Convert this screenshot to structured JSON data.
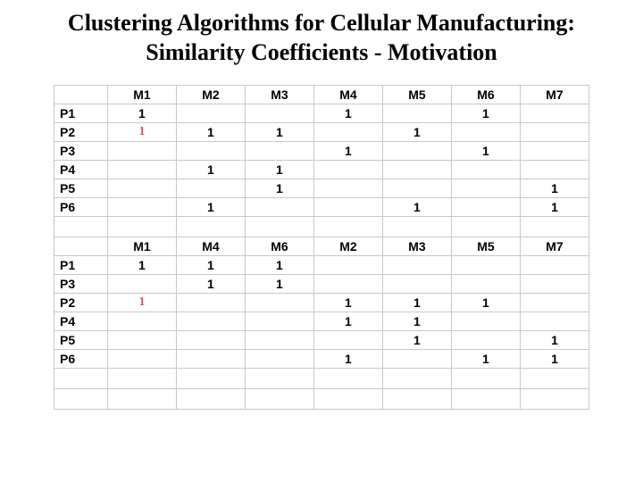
{
  "title_line1": "Clustering Algorithms for Cellular Manufacturing:",
  "title_line2": "Similarity Coefficients - Motivation",
  "table1": {
    "headers": [
      "",
      "M1",
      "M2",
      "M3",
      "M4",
      "M5",
      "M6",
      "M7"
    ],
    "rows": [
      {
        "label": "P1",
        "cells": [
          "1",
          "",
          "",
          "1",
          "",
          "1",
          ""
        ]
      },
      {
        "label": "P2",
        "cells": [
          "1",
          "1",
          "1",
          "",
          "1",
          "",
          ""
        ],
        "red_cols": [
          0
        ]
      },
      {
        "label": "P3",
        "cells": [
          "",
          "",
          "",
          "1",
          "",
          "1",
          ""
        ]
      },
      {
        "label": "P4",
        "cells": [
          "",
          "1",
          "1",
          "",
          "",
          "",
          ""
        ]
      },
      {
        "label": "P5",
        "cells": [
          "",
          "",
          "1",
          "",
          "",
          "",
          "1"
        ]
      },
      {
        "label": "P6",
        "cells": [
          "",
          "1",
          "",
          "",
          "1",
          "",
          "1"
        ]
      }
    ]
  },
  "table2": {
    "headers": [
      "",
      "M1",
      "M4",
      "M6",
      "M2",
      "M3",
      "M5",
      "M7"
    ],
    "rows": [
      {
        "label": "P1",
        "cells": [
          "1",
          "1",
          "1",
          "",
          "",
          "",
          ""
        ]
      },
      {
        "label": "P3",
        "cells": [
          "",
          "1",
          "1",
          "",
          "",
          "",
          ""
        ]
      },
      {
        "label": "P2",
        "cells": [
          "1",
          "",
          "",
          "1",
          "1",
          "1",
          ""
        ],
        "red_cols": [
          0
        ]
      },
      {
        "label": "P4",
        "cells": [
          "",
          "",
          "",
          "1",
          "1",
          "",
          ""
        ]
      },
      {
        "label": "P5",
        "cells": [
          "",
          "",
          "",
          "",
          "1",
          "",
          "1"
        ]
      },
      {
        "label": "P6",
        "cells": [
          "",
          "",
          "",
          "1",
          "",
          "1",
          "1"
        ]
      }
    ]
  }
}
